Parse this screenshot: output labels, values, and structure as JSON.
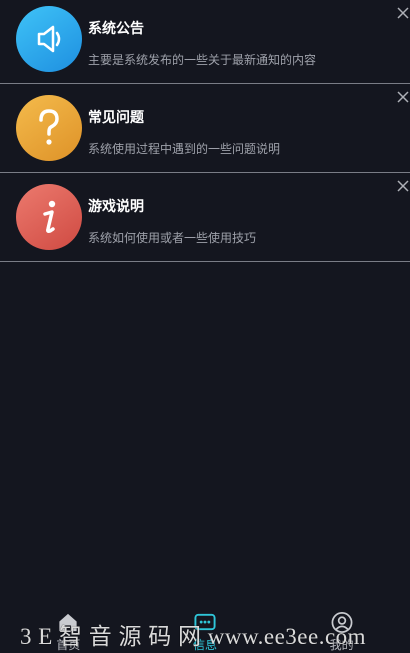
{
  "items": [
    {
      "title": "系统公告",
      "desc": "主要是系统发布的一些关于最新通知的内容",
      "icon": "speaker-icon",
      "color": "#2aa8e8"
    },
    {
      "title": "常见问题",
      "desc": "系统使用过程中遇到的一些问题说明",
      "icon": "question-icon",
      "color": "#e9a53a"
    },
    {
      "title": "游戏说明",
      "desc": "系统如何使用或者一些使用技巧",
      "icon": "info-icon",
      "color": "#d9584f"
    }
  ],
  "tabbar": {
    "home": "首页",
    "messages": "信息",
    "mine": "我的",
    "active_color": "#2fc6d9"
  },
  "watermark": "3 E 智 音 源 码 网 www.ee3ee.com"
}
